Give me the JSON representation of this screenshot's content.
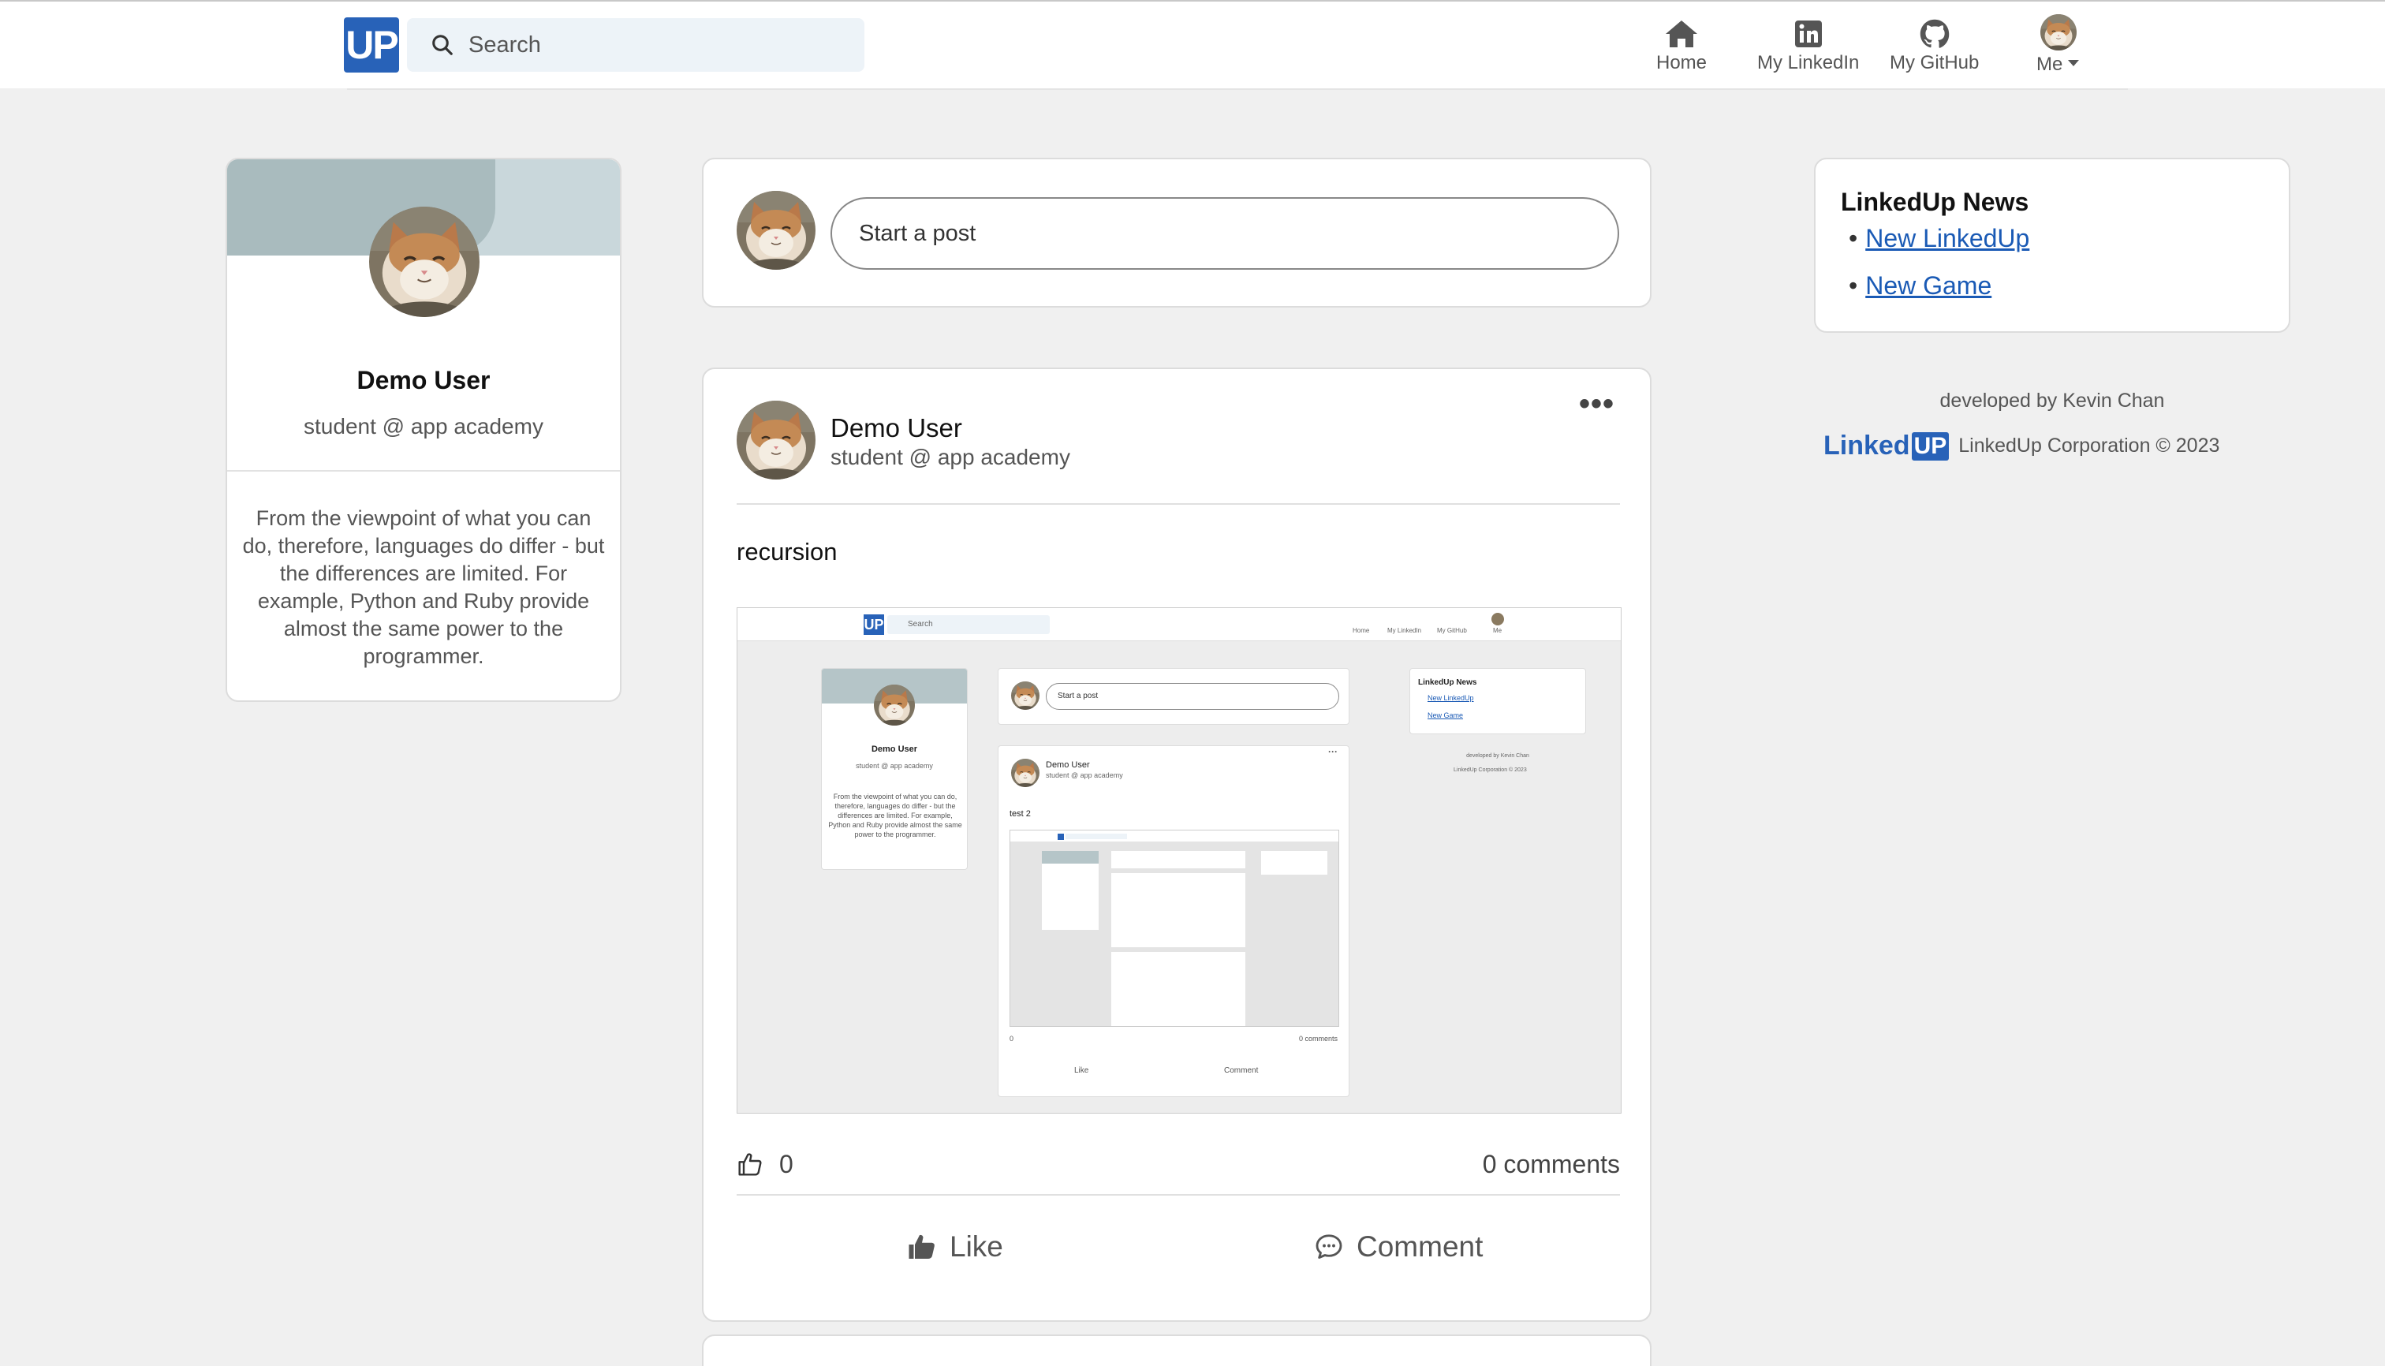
{
  "nav": {
    "logo": "UP",
    "search_placeholder": "Search",
    "items": [
      {
        "label": "Home",
        "icon": "home-icon"
      },
      {
        "label": "My LinkedIn",
        "icon": "linkedin-icon"
      },
      {
        "label": "My GitHub",
        "icon": "github-icon"
      },
      {
        "label": "Me",
        "icon": "chevron-down-icon"
      }
    ]
  },
  "profile": {
    "name": "Demo User",
    "title": "student @ app academy",
    "bio": "From the viewpoint of what you can do, therefore, languages do differ - but the differences are limited. For example, Python and Ruby provide almost the same power to the programmer."
  },
  "composer": {
    "placeholder": "Start a post"
  },
  "post": {
    "author": "Demo User",
    "subtitle": "student @ app academy",
    "body": "recursion",
    "more": "•••",
    "likes": "0",
    "comments": "0 comments",
    "like_label": "Like",
    "comment_label": "Comment",
    "image": {
      "search": "Search",
      "nav": [
        "Home",
        "My LinkedIn",
        "My GitHub",
        "Me"
      ],
      "profile_name": "Demo User",
      "profile_title": "student @ app academy",
      "profile_bio": "From the viewpoint of what you can do, therefore, languages do differ - but the differences are limited. For example, Python and Ruby provide almost the same power to the programmer.",
      "composer": "Start a post",
      "post_author": "Demo User",
      "post_subtitle": "student @ app academy",
      "post_body": "test 2",
      "likes": "0",
      "comments": "0 comments",
      "like_label": "Like",
      "comment_label": "Comment",
      "news_title": "LinkedUp News",
      "news_links": [
        "New LinkedUp",
        "New Game"
      ],
      "developer": "developed by Kevin Chan",
      "corporation": "LinkedUp Corporation © 2023"
    }
  },
  "news": {
    "title": "LinkedUp News",
    "links": [
      "New LinkedUp",
      "New Game"
    ]
  },
  "footer": {
    "developer": "developed by Kevin Chan",
    "brand_text": "Linked",
    "brand_box": "UP",
    "corporation": "LinkedUp Corporation © 2023"
  },
  "colors": {
    "brand": "#2862b8",
    "background": "#f0f0f0",
    "card": "#ffffff"
  }
}
